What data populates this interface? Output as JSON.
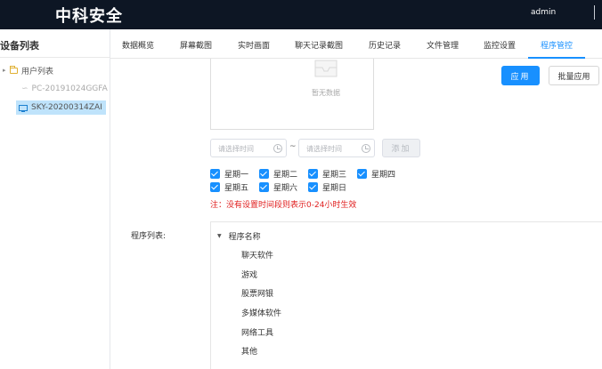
{
  "header": {
    "title": "中科安全",
    "user": "admin"
  },
  "sidebar": {
    "title": "设备列表",
    "tree": {
      "root_label": "用户列表",
      "devices": [
        {
          "label": "PC-20191024GGFA",
          "status": "offline"
        },
        {
          "label": "SKY-20200314ZAI",
          "status": "selected"
        }
      ]
    }
  },
  "tabs": [
    {
      "label": "数据概览"
    },
    {
      "label": "屏幕截图"
    },
    {
      "label": "实时画面"
    },
    {
      "label": "聊天记录截图"
    },
    {
      "label": "历史记录"
    },
    {
      "label": "文件管理"
    },
    {
      "label": "监控设置"
    },
    {
      "label": "程序管控",
      "active": true
    }
  ],
  "time_list": {
    "empty_text": "暂无数据"
  },
  "actions": {
    "apply_label": "应用",
    "batch_apply_label": "批量应用"
  },
  "time_range": {
    "start_placeholder": "请选择时间",
    "separator": "~",
    "end_placeholder": "请选择时间",
    "add_label": "添加"
  },
  "weekdays": [
    {
      "label": "星期一",
      "checked": true
    },
    {
      "label": "星期二",
      "checked": true
    },
    {
      "label": "星期三",
      "checked": true
    },
    {
      "label": "星期四",
      "checked": true
    },
    {
      "label": "星期五",
      "checked": true
    },
    {
      "label": "星期六",
      "checked": true
    },
    {
      "label": "星期日",
      "checked": true
    }
  ],
  "note": "注：没有设置时间段则表示0-24小时生效",
  "program_list": {
    "label": "程序列表:",
    "root_label": "程序名称",
    "items": [
      "聊天软件",
      "游戏",
      "股票网银",
      "多媒体软件",
      "网络工具",
      "其他"
    ]
  },
  "colors": {
    "primary": "#1890ff",
    "header_bg": "#0d1624",
    "danger": "#e02020"
  }
}
